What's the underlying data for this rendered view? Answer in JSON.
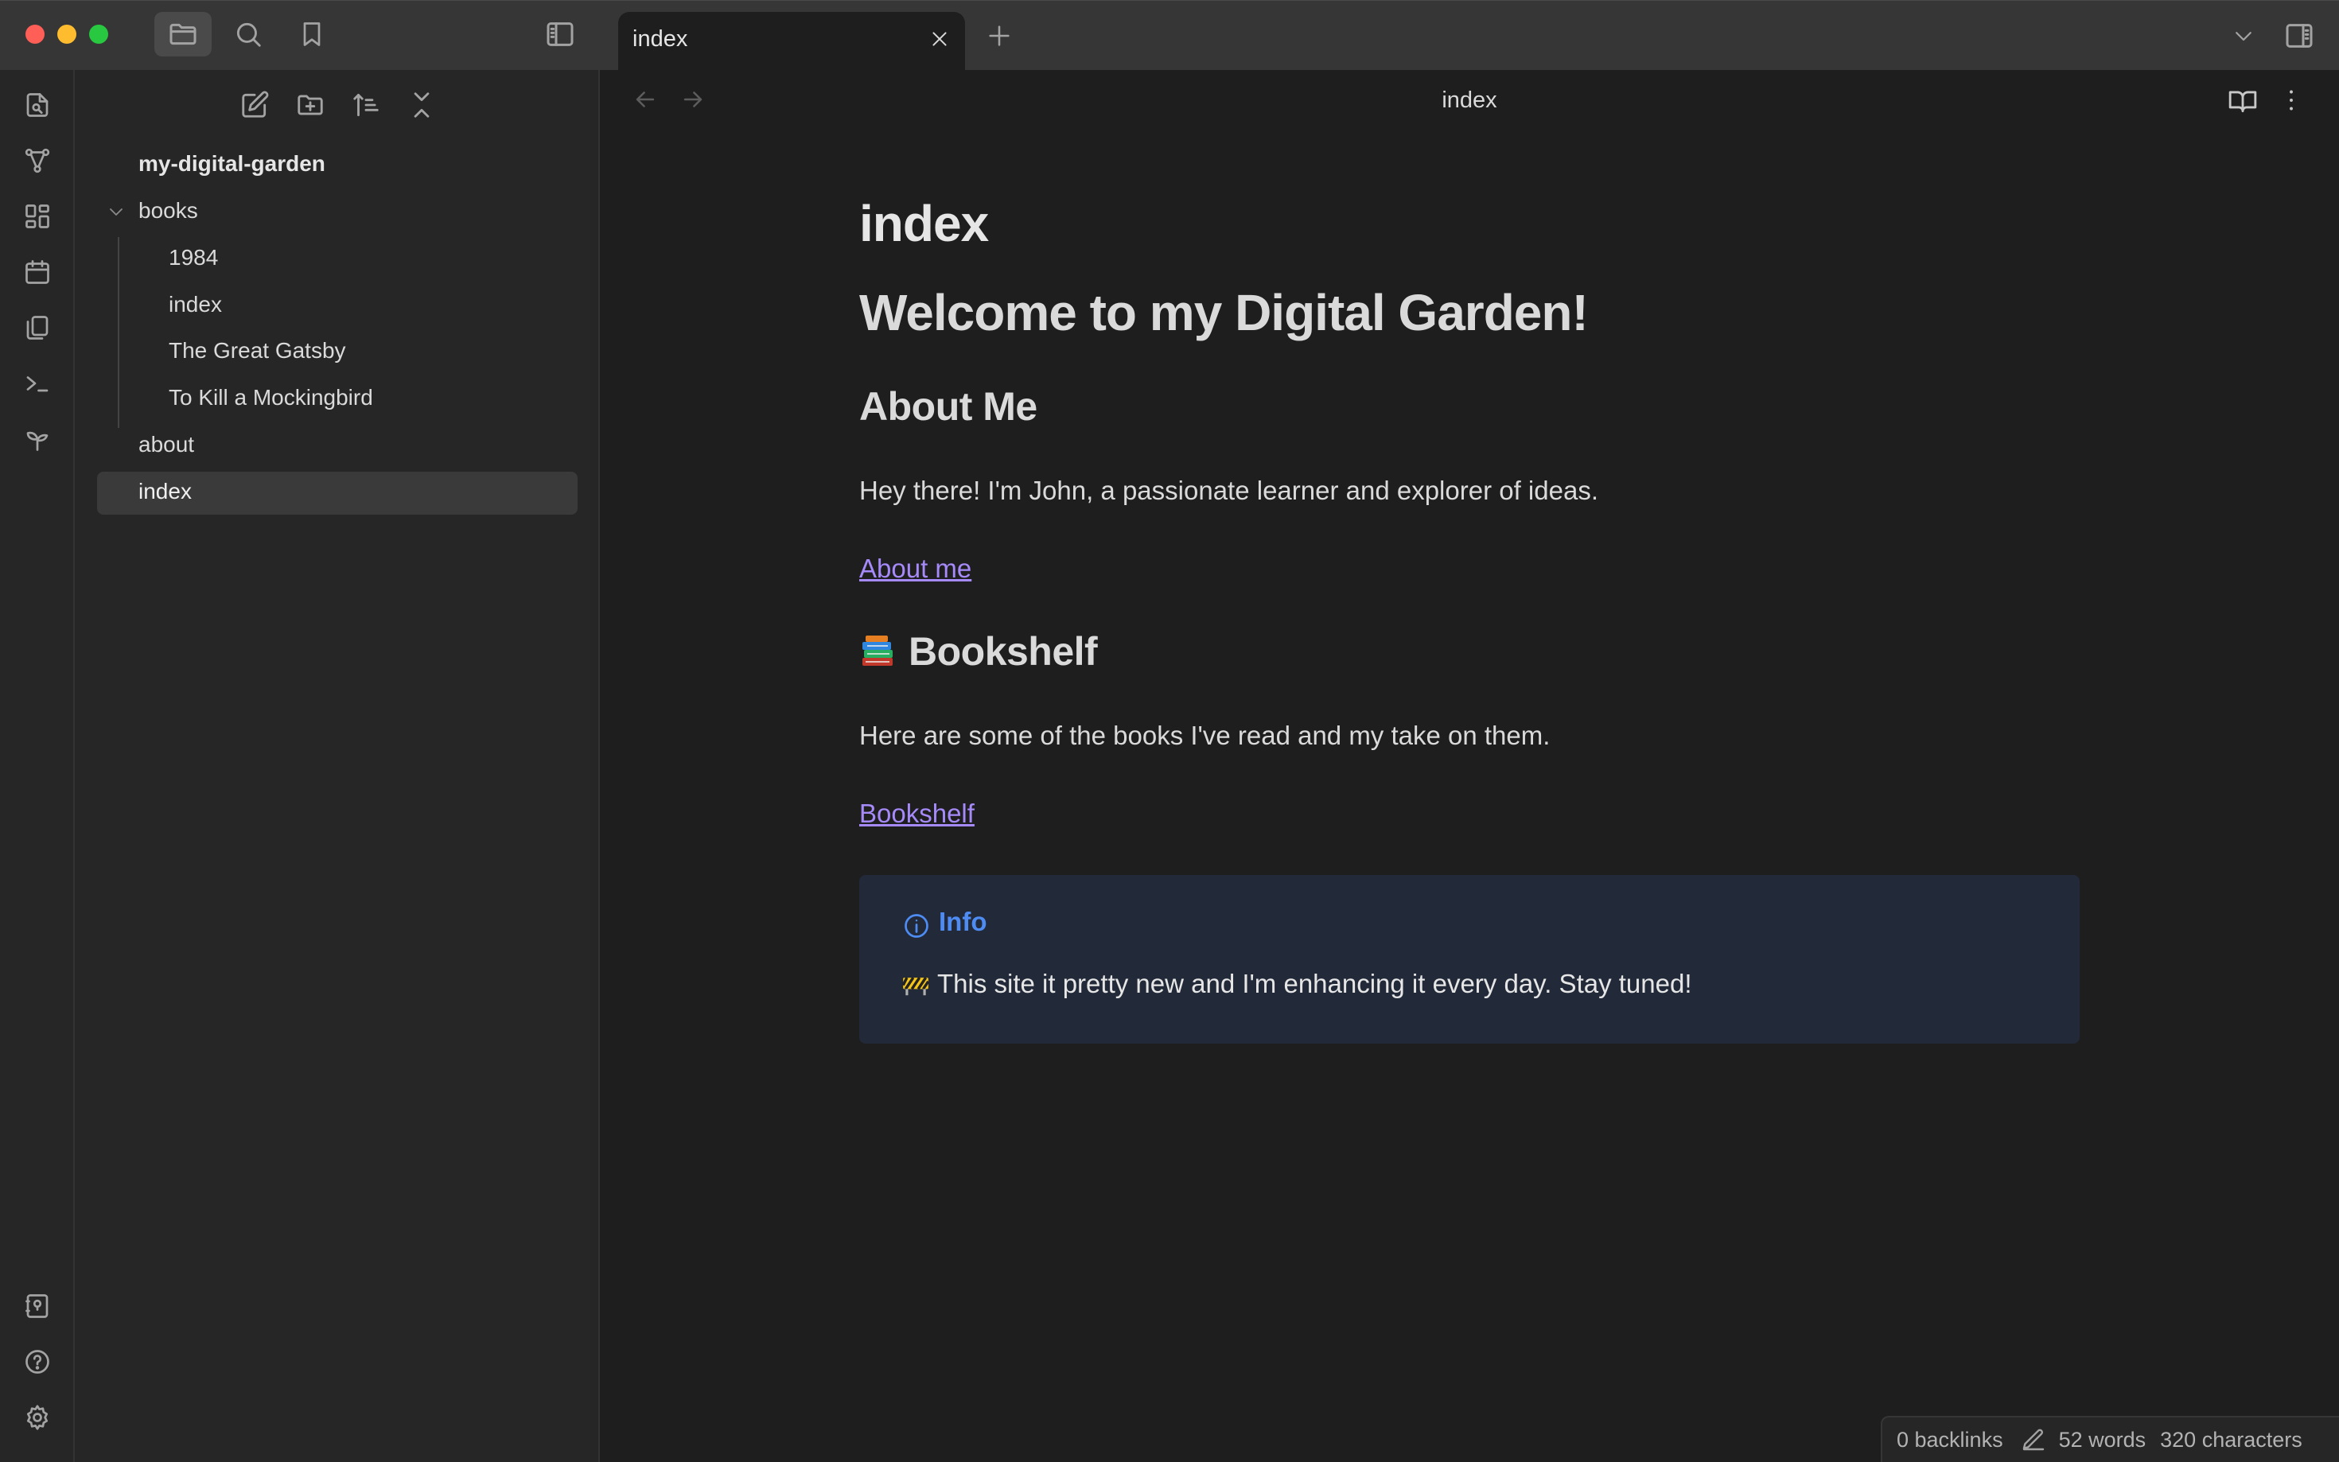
{
  "titlebar": {
    "tab": {
      "title": "index"
    },
    "icons": [
      "folder-icon",
      "search-icon",
      "bookmark-icon",
      "sidebar-toggle-icon",
      "close-icon",
      "plus-icon",
      "chevron-down-icon",
      "right-sidebar-icon"
    ]
  },
  "ribbon": {
    "icons": [
      "quick-switcher-icon",
      "graph-view-icon",
      "canvas-icon",
      "daily-note-icon",
      "templates-icon",
      "command-palette-icon",
      "publish-icon",
      "vault-switcher-icon",
      "help-icon",
      "settings-icon"
    ]
  },
  "explorer": {
    "actions": [
      "new-note-icon",
      "new-folder-icon",
      "sort-icon",
      "collapse-all-icon"
    ],
    "vault": "my-digital-garden",
    "items": [
      {
        "label": "books",
        "type": "folder",
        "expanded": true
      },
      {
        "label": "1984",
        "type": "file"
      },
      {
        "label": "index",
        "type": "file"
      },
      {
        "label": "The Great Gatsby",
        "type": "file"
      },
      {
        "label": "To Kill a Mockingbird",
        "type": "file"
      },
      {
        "label": "about",
        "type": "file"
      },
      {
        "label": "index",
        "type": "file",
        "selected": true
      }
    ]
  },
  "view": {
    "title": "index",
    "inline_title": "index",
    "h1": "Welcome to my Digital Garden!",
    "about_heading": "About Me",
    "about_text": "Hey there! I'm John, a passionate learner and explorer of ideas.",
    "about_link": "About me",
    "bookshelf_emoji": "📚",
    "bookshelf_heading": "Bookshelf",
    "bookshelf_text": "Here are some of the books I've read and my take on them.",
    "bookshelf_link": "Bookshelf",
    "callout": {
      "title": "Info",
      "emoji": "🚧",
      "body": "This site it pretty new and I'm enhancing it every day. Stay tuned!"
    }
  },
  "statusbar": {
    "backlinks": "0 backlinks",
    "words": "52 words",
    "characters": "320 characters"
  },
  "colors": {
    "background": "#1e1e1e",
    "sidebar": "#262626",
    "titlebar": "#363636",
    "link": "#a68af9",
    "callout_bg": "#222938",
    "callout_accent": "#4e8cf4"
  }
}
